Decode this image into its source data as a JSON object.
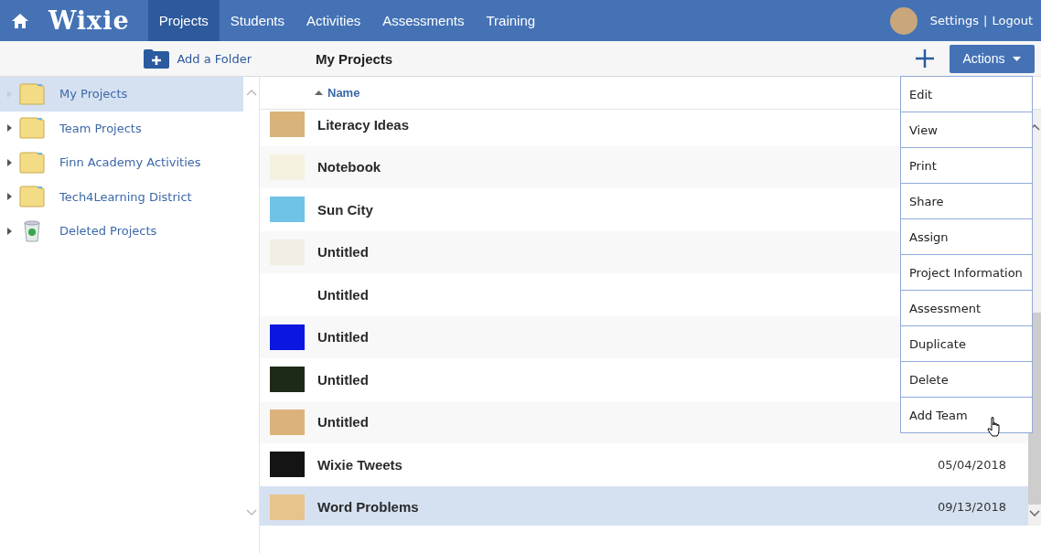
{
  "nav": {
    "logo": "Wixie",
    "items": [
      {
        "label": "Projects",
        "selected": true
      },
      {
        "label": "Students",
        "selected": false
      },
      {
        "label": "Activities",
        "selected": false
      },
      {
        "label": "Assessments",
        "selected": false
      },
      {
        "label": "Training",
        "selected": false
      }
    ],
    "settings": "Settings",
    "separator": "|",
    "logout": "Logout"
  },
  "toolbar": {
    "add_folder": "Add a Folder",
    "title": "My Projects",
    "actions": "Actions"
  },
  "sidebar": {
    "items": [
      {
        "label": "My Projects",
        "kind": "folder",
        "selected": true,
        "expandable": false
      },
      {
        "label": "Team Projects",
        "kind": "folder",
        "selected": false,
        "expandable": true
      },
      {
        "label": "Finn Academy Activities",
        "kind": "folder",
        "selected": false,
        "expandable": true
      },
      {
        "label": "Tech4Learning District",
        "kind": "folder",
        "selected": false,
        "expandable": true
      },
      {
        "label": "Deleted Projects",
        "kind": "trash",
        "selected": false,
        "expandable": true
      }
    ]
  },
  "table": {
    "columns": [
      {
        "label": "Name",
        "sorted": true
      }
    ],
    "rows": [
      {
        "name": "Literacy Ideas",
        "thumbnail": true,
        "color": "#d9b37a",
        "selected": false
      },
      {
        "name": "Notebook",
        "thumbnail": true,
        "color": "#f4f1e0",
        "selected": false
      },
      {
        "name": "Sun City",
        "thumbnail": true,
        "color": "#6fc3e6",
        "selected": false
      },
      {
        "name": "Untitled",
        "thumbnail": true,
        "color": "#f2eee4",
        "selected": false
      },
      {
        "name": "Untitled",
        "thumbnail": false,
        "selected": false
      },
      {
        "name": "Untitled",
        "thumbnail": true,
        "color": "#0b16e0",
        "selected": false
      },
      {
        "name": "Untitled",
        "thumbnail": true,
        "color": "#1e2a18",
        "selected": false
      },
      {
        "name": "Untitled",
        "thumbnail": true,
        "color": "#dcb27c",
        "selected": false
      },
      {
        "name": "Wixie Tweets",
        "thumbnail": true,
        "color": "#141414",
        "date": "05/04/2018",
        "selected": false
      },
      {
        "name": "Word Problems",
        "thumbnail": true,
        "color": "#e6c48c",
        "date": "09/13/2018",
        "selected": true
      }
    ]
  },
  "actions_menu": {
    "items": [
      "Edit",
      "View",
      "Print",
      "Share",
      "Assign",
      "Project Information",
      "Assessment",
      "Duplicate",
      "Delete",
      "Add Team"
    ]
  }
}
